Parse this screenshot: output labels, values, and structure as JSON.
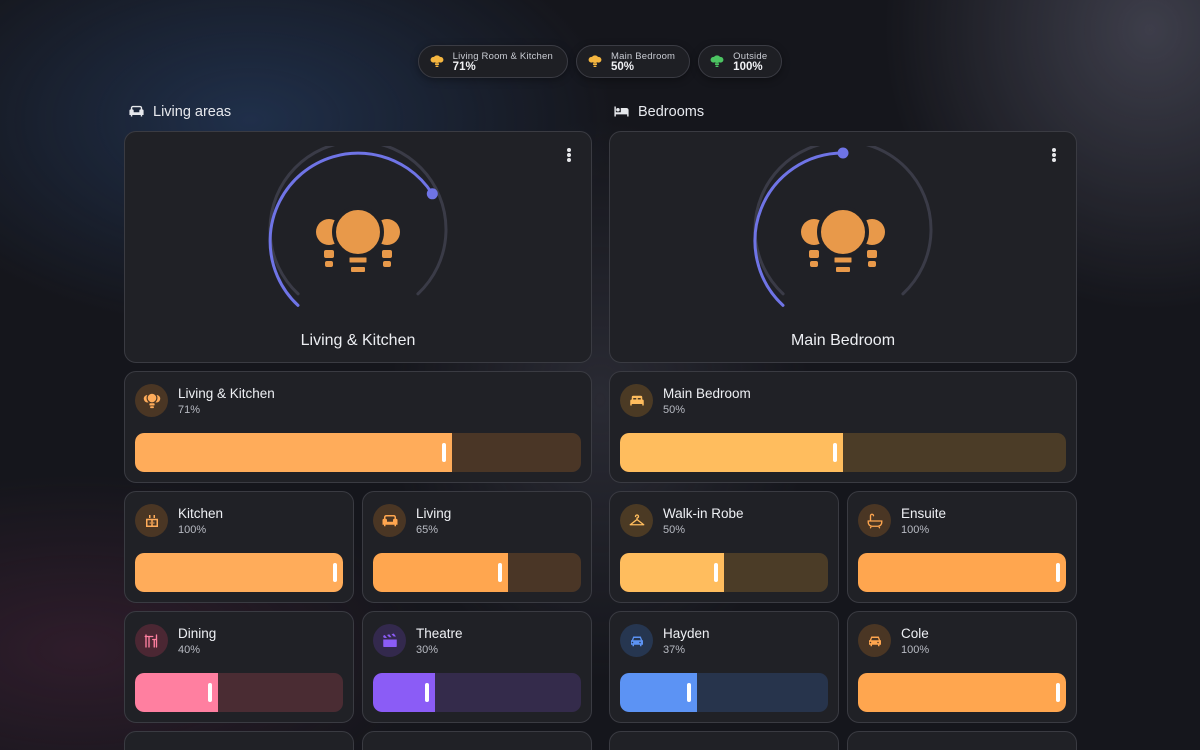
{
  "status_pills": [
    {
      "name": "Living Room & Kitchen",
      "value": "71%",
      "color": "#f5b640"
    },
    {
      "name": "Main Bedroom",
      "value": "50%",
      "color": "#f5b640"
    },
    {
      "name": "Outside",
      "value": "100%",
      "color": "#4cc462"
    }
  ],
  "sections": {
    "living": {
      "title": "Living areas",
      "icon": "sofa-icon"
    },
    "bedrooms": {
      "title": "Bedrooms",
      "icon": "bed-icon"
    }
  },
  "heroes": {
    "living": {
      "label": "Living & Kitchen",
      "level": 0.71,
      "icon": "multi-bulb-icon"
    },
    "bedroom": {
      "label": "Main Bedroom",
      "level": 0.5,
      "icon": "multi-bulb-icon"
    }
  },
  "tiles": {
    "living_kitchen": {
      "name": "Living & Kitchen",
      "percent": "71%",
      "level": 0.71,
      "icon": "multi-bulb-icon",
      "accent": "#ffac5a",
      "icon_bg": "#4a3624",
      "track": "#4a3626"
    },
    "main_bedroom": {
      "name": "Main Bedroom",
      "percent": "50%",
      "level": 0.5,
      "icon": "bed-icon",
      "accent": "#ffbd5e",
      "icon_bg": "#4b3a24",
      "track": "#4b3c27"
    },
    "kitchen": {
      "name": "Kitchen",
      "percent": "100%",
      "level": 1.0,
      "icon": "kitchen-icon",
      "accent": "#ffac5a",
      "icon_bg": "#4a3624",
      "track": "#4a3626"
    },
    "living": {
      "name": "Living",
      "percent": "65%",
      "level": 0.65,
      "icon": "sofa-icon",
      "accent": "#ffa64f",
      "icon_bg": "#4a3624",
      "track": "#4a3626"
    },
    "walk_in_robe": {
      "name": "Walk-in Robe",
      "percent": "50%",
      "level": 0.5,
      "icon": "hanger-icon",
      "accent": "#ffbd5e",
      "icon_bg": "#4b3a24",
      "track": "#4b3c27"
    },
    "ensuite": {
      "name": "Ensuite",
      "percent": "100%",
      "level": 1.0,
      "icon": "bathtub-icon",
      "accent": "#ffa64f",
      "icon_bg": "#4a3624",
      "track": "#4a3626"
    },
    "dining": {
      "name": "Dining",
      "percent": "40%",
      "level": 0.4,
      "icon": "dining-table-icon",
      "accent": "#ff7fa0",
      "icon_bg": "#4b2733",
      "track": "#4a2c33"
    },
    "theatre": {
      "name": "Theatre",
      "percent": "30%",
      "level": 0.3,
      "icon": "clapperboard-icon",
      "accent": "#8b5cf6",
      "icon_bg": "#33294d",
      "track": "#342b4b"
    },
    "hayden": {
      "name": "Hayden",
      "percent": "37%",
      "level": 0.37,
      "icon": "car-icon",
      "accent": "#5c93f4",
      "icon_bg": "#263650",
      "track": "#27344c"
    },
    "cole": {
      "name": "Cole",
      "percent": "100%",
      "level": 1.0,
      "icon": "car-icon",
      "accent": "#ffa64f",
      "icon_bg": "#4a3624",
      "track": "#4a3626"
    }
  },
  "colors": {
    "gauge_arc": "#6f74e6",
    "gauge_track": "#3a3b47",
    "bulb": "#e8994a"
  }
}
